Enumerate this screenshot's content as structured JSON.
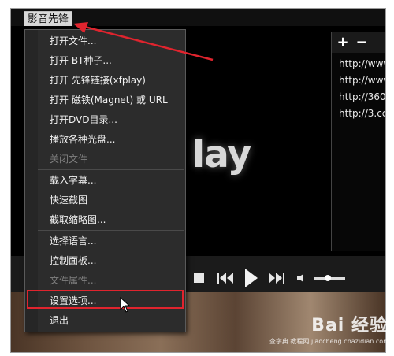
{
  "app": {
    "title": "影音先锋"
  },
  "logo_text": "lay",
  "menu": {
    "items": [
      {
        "label": "打开文件...",
        "enabled": true
      },
      {
        "label": "打开 BT种子...",
        "enabled": true
      },
      {
        "label": "打开 先锋链接(xfplay)",
        "enabled": true
      },
      {
        "label": "打开 磁铁(Magnet) 或 URL",
        "enabled": true
      },
      {
        "label": "打开DVD目录...",
        "enabled": true
      },
      {
        "label": "播放各种光盘...",
        "enabled": true
      },
      {
        "label": "关闭文件",
        "enabled": false
      },
      {
        "label": "载入字幕...",
        "enabled": true
      },
      {
        "label": "快速截图",
        "enabled": true
      },
      {
        "label": "截取缩略图...",
        "enabled": true
      },
      {
        "label": "选择语言...",
        "enabled": true
      },
      {
        "label": "控制面板...",
        "enabled": true
      },
      {
        "label": "文件属性...",
        "enabled": false
      },
      {
        "label": "设置选项...",
        "enabled": true,
        "highlighted": true
      },
      {
        "label": "退出",
        "enabled": true
      }
    ]
  },
  "playlist": {
    "add_label": "+",
    "remove_label": "−",
    "items": [
      "http://www",
      "http://www",
      "http://360",
      "http://3.cc"
    ]
  },
  "controls": {
    "volume_level": 0.45
  },
  "watermark": {
    "text": "Bai 经验",
    "sub": "查字典 教程网 jiaocheng.chazidian.com"
  },
  "colors": {
    "annotation_red": "#e0242e",
    "menu_bg": "#2c2c2c",
    "disabled_text": "#808080"
  }
}
